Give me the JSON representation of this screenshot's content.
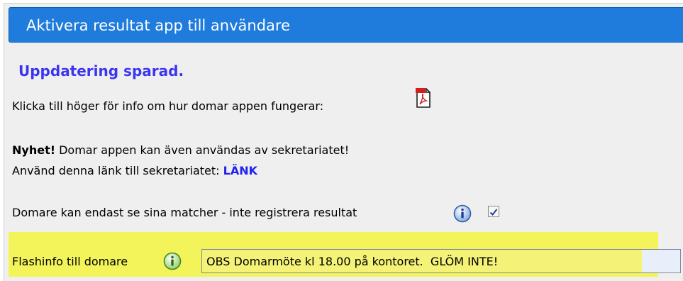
{
  "header": {
    "title": "Aktivera resultat app till användare"
  },
  "status": {
    "message": "Uppdatering sparad."
  },
  "info": {
    "text": "Klicka till höger för info om hur domar appen fungerar:",
    "icon": "pdf-icon"
  },
  "news": {
    "label": "Nyhet!",
    "text": " Domar appen kan även användas av sekretariatet!",
    "link_prefix": "Använd denna länk till sekretariatet: ",
    "link_label": "LÄNK"
  },
  "restriction": {
    "label": "Domare kan endast se sina matcher - inte registrera resultat",
    "icon": "info-icon",
    "checked": true
  },
  "flashinfo": {
    "label": "Flashinfo till domare",
    "icon": "info-icon",
    "value": "OBS Domarmöte kl 18.00 på kontoret.  GLÖM INTE!"
  },
  "colors": {
    "header_bg": "#1f7bdc",
    "status_text": "#3b35f2",
    "link": "#2222ee",
    "highlight": "#f3f35a"
  }
}
